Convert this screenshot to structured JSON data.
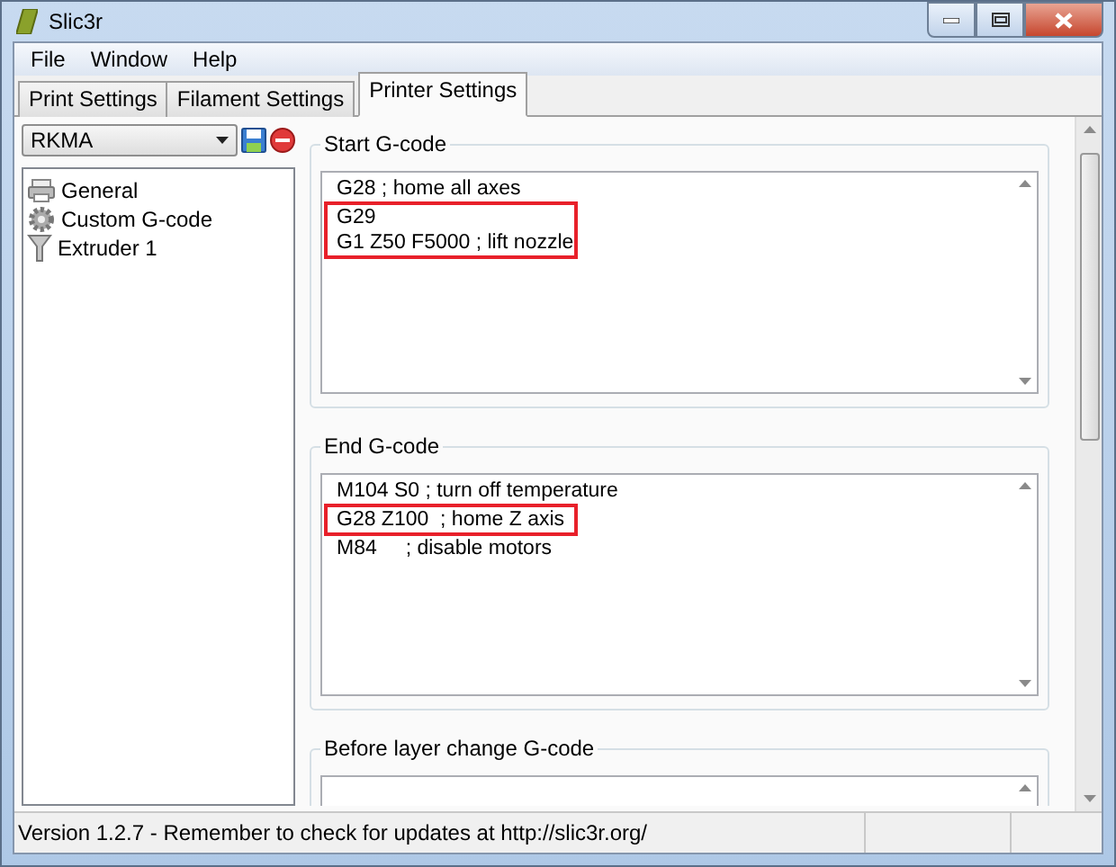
{
  "window": {
    "title": "Slic3r"
  },
  "menu": [
    "File",
    "Window",
    "Help"
  ],
  "tabs": [
    {
      "label": "Print Settings",
      "selected": false
    },
    {
      "label": "Filament Settings",
      "selected": false
    },
    {
      "label": "Printer Settings",
      "selected": true
    }
  ],
  "preset": {
    "value": "RKMA"
  },
  "sidebar": {
    "items": [
      {
        "label": "General",
        "kind": "printer"
      },
      {
        "label": "Custom G-code",
        "kind": "gear"
      },
      {
        "label": "Extruder 1",
        "kind": "funnel"
      }
    ]
  },
  "sections": [
    {
      "title": "Start G-code",
      "lines": [
        {
          "text": "G28 ; home all axes",
          "highlighted": false
        },
        {
          "text": "G29",
          "highlighted": true
        },
        {
          "text": "G1 Z50 F5000 ; lift nozzle",
          "highlighted": true
        }
      ]
    },
    {
      "title": "End G-code",
      "lines": [
        {
          "text": "M104 S0 ; turn off temperature",
          "highlighted": false
        },
        {
          "text": "G28 Z100  ; home Z axis",
          "highlighted": true
        },
        {
          "text": "M84     ; disable motors",
          "highlighted": false
        }
      ]
    },
    {
      "title": "Before layer change G-code"
    }
  ],
  "status_bar": {
    "text": "Version 1.2.7 - Remember to check for updates at http://slic3r.org/"
  }
}
